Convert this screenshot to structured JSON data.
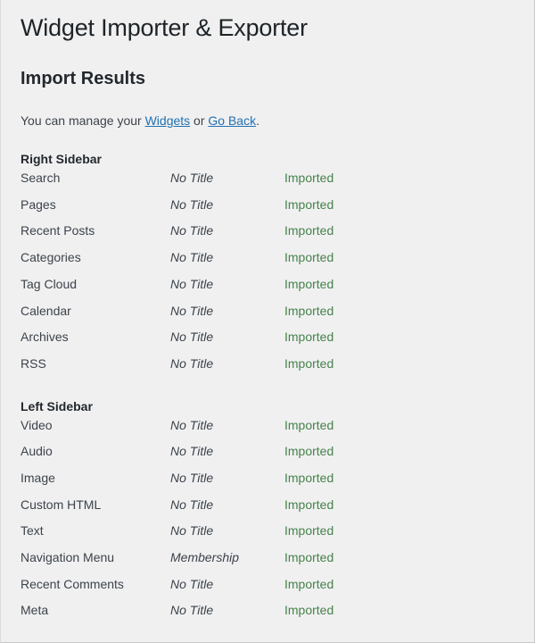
{
  "page": {
    "title": "Widget Importer & Exporter",
    "section_heading": "Import Results",
    "manage": {
      "prefix": "You can manage your ",
      "widgets_link": "Widgets",
      "separator": " or ",
      "goback_link": "Go Back",
      "suffix": "."
    }
  },
  "colors": {
    "background": "#f0f0f1",
    "title": "#1d2327",
    "heading": "#23282d",
    "body_text": "#3c434a",
    "link": "#2271b1",
    "status_imported": "#46824a",
    "border": "#c8c8c8"
  },
  "results": {
    "groups": [
      {
        "heading": "Right Sidebar",
        "rows": [
          {
            "name": "Search",
            "title": "No Title",
            "status": "Imported"
          },
          {
            "name": "Pages",
            "title": "No Title",
            "status": "Imported"
          },
          {
            "name": "Recent Posts",
            "title": "No Title",
            "status": "Imported"
          },
          {
            "name": "Categories",
            "title": "No Title",
            "status": "Imported"
          },
          {
            "name": "Tag Cloud",
            "title": "No Title",
            "status": "Imported"
          },
          {
            "name": "Calendar",
            "title": "No Title",
            "status": "Imported"
          },
          {
            "name": "Archives",
            "title": "No Title",
            "status": "Imported"
          },
          {
            "name": "RSS",
            "title": "No Title",
            "status": "Imported"
          }
        ]
      },
      {
        "heading": "Left Sidebar",
        "rows": [
          {
            "name": "Video",
            "title": "No Title",
            "status": "Imported"
          },
          {
            "name": "Audio",
            "title": "No Title",
            "status": "Imported"
          },
          {
            "name": "Image",
            "title": "No Title",
            "status": "Imported"
          },
          {
            "name": "Custom HTML",
            "title": "No Title",
            "status": "Imported"
          },
          {
            "name": "Text",
            "title": "No Title",
            "status": "Imported"
          },
          {
            "name": "Navigation Menu",
            "title": "Membership",
            "status": "Imported"
          },
          {
            "name": "Recent Comments",
            "title": "No Title",
            "status": "Imported"
          },
          {
            "name": "Meta",
            "title": "No Title",
            "status": "Imported"
          }
        ]
      }
    ]
  }
}
